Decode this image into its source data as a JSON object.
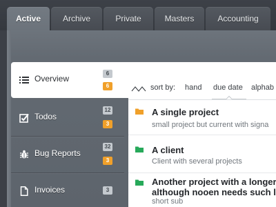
{
  "tabs": [
    {
      "label": "Active",
      "active": true
    },
    {
      "label": "Archive",
      "active": false
    },
    {
      "label": "Private",
      "active": false
    },
    {
      "label": "Masters",
      "active": false
    },
    {
      "label": "Accounting",
      "active": false
    }
  ],
  "sidebar": {
    "items": [
      {
        "label": "Overview",
        "icon": "list-icon",
        "badges": [
          "6",
          "6"
        ],
        "active": true
      },
      {
        "label": "Todos",
        "icon": "checkbox-icon",
        "badges": [
          "12",
          "3"
        ],
        "active": false
      },
      {
        "label": "Bug Reports",
        "icon": "bug-icon",
        "badges": [
          "32",
          "3"
        ],
        "active": false
      },
      {
        "label": "Invoices",
        "icon": "document-icon",
        "badges": [
          "3"
        ],
        "active": false
      }
    ]
  },
  "sort": {
    "label": "sort by:",
    "options": [
      "hand",
      "due date",
      "alphab"
    ],
    "selected": "due date"
  },
  "projects": [
    {
      "title": "A single project",
      "subtitle": "small project but current with signa",
      "folder_color": "#f0a02a"
    },
    {
      "title": "A client",
      "subtitle": "Client with several projects",
      "folder_color": "#27a95a"
    },
    {
      "title_line1": "Another project with a longer",
      "title_line2": "although nooen needs such l",
      "subtitle": "short sub",
      "folder_color": "#27a95a"
    }
  ],
  "colors": {
    "accent_orange": "#f0a02a",
    "accent_green": "#27a95a",
    "panel": "#6c737b"
  }
}
